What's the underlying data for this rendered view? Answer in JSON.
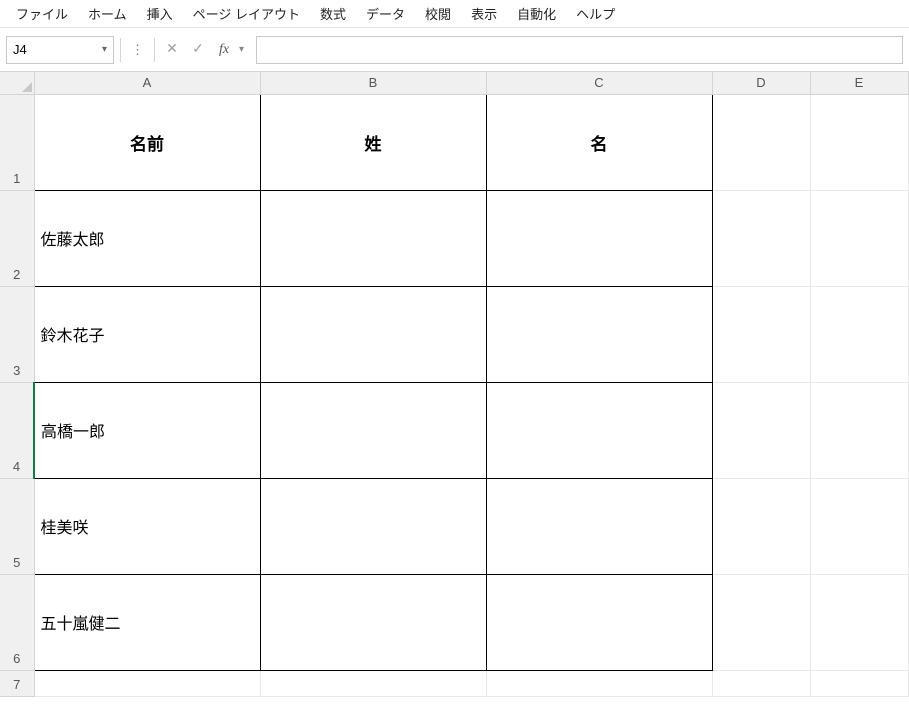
{
  "menu": {
    "file": "ファイル",
    "home": "ホーム",
    "insert": "挿入",
    "page_layout": "ページ レイアウト",
    "formulas": "数式",
    "data": "データ",
    "review": "校閲",
    "view": "表示",
    "automate": "自動化",
    "help": "ヘルプ"
  },
  "formula_bar": {
    "name_box": "J4",
    "cancel_glyph": "✕",
    "enter_glyph": "✓",
    "fx_label": "fx",
    "input_value": ""
  },
  "columns": {
    "A": "A",
    "B": "B",
    "C": "C",
    "D": "D",
    "E": "E"
  },
  "rows": {
    "1": "1",
    "2": "2",
    "3": "3",
    "4": "4",
    "5": "5",
    "6": "6",
    "7": "7"
  },
  "cells": {
    "A1": "名前",
    "B1": "姓",
    "C1": "名",
    "A2": "佐藤太郎",
    "A3": "鈴木花子",
    "A4": "高橋一郎",
    "A5": "桂美咲",
    "A6": "五十嵐健二"
  }
}
